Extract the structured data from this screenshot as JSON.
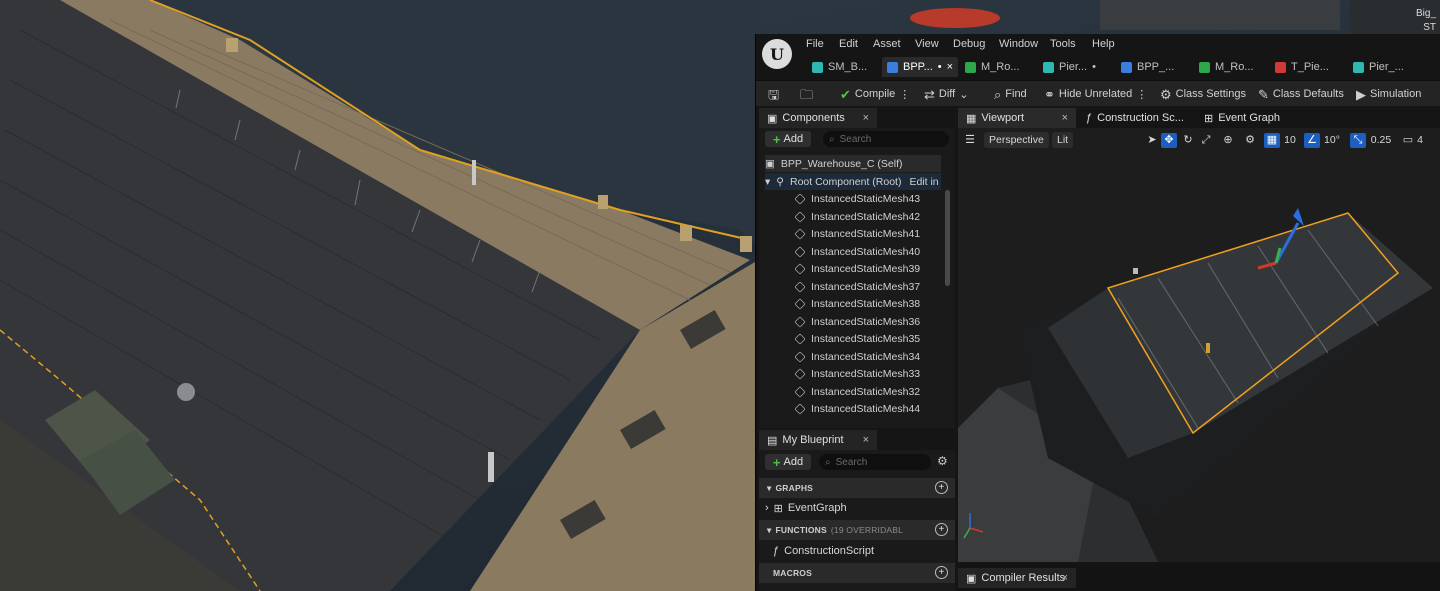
{
  "scene": {
    "corner_labels": [
      "Big_",
      "ST"
    ]
  },
  "editor": {
    "menu": [
      "File",
      "Edit",
      "Asset",
      "View",
      "Debug",
      "Window",
      "Tools",
      "Help"
    ],
    "tabs": [
      {
        "label": "SM_B...",
        "color": "#2fb8b0",
        "active": false,
        "dot": ""
      },
      {
        "label": "BPP...",
        "color": "#3a7fe0",
        "active": true,
        "dot": "•"
      },
      {
        "label": "M_Ro...",
        "color": "#2aa84a",
        "active": false,
        "dot": ""
      },
      {
        "label": "Pier...",
        "color": "#2fb8b0",
        "active": false,
        "dot": "•"
      },
      {
        "label": "BPP_...",
        "color": "#3a7fe0",
        "active": false,
        "dot": ""
      },
      {
        "label": "M_Ro...",
        "color": "#2aa84a",
        "active": false,
        "dot": ""
      },
      {
        "label": "T_Pie...",
        "color": "#d03a3a",
        "active": false,
        "dot": ""
      },
      {
        "label": "Pier_...",
        "color": "#2fb8b0",
        "active": false,
        "dot": ""
      }
    ],
    "toolbar": {
      "compile": "Compile",
      "diff": "Diff",
      "find": "Find",
      "hide_unrelated": "Hide Unrelated",
      "class_settings": "Class Settings",
      "class_defaults": "Class Defaults",
      "simulation": "Simulation"
    },
    "components": {
      "title": "Components",
      "add": "Add",
      "search_placeholder": "Search",
      "self": "BPP_Warehouse_C (Self)",
      "root": "Root Component (Root)",
      "edit_in": "Edit in",
      "items": [
        "InstancedStaticMesh43",
        "InstancedStaticMesh42",
        "InstancedStaticMesh41",
        "InstancedStaticMesh40",
        "InstancedStaticMesh39",
        "InstancedStaticMesh37",
        "InstancedStaticMesh38",
        "InstancedStaticMesh36",
        "InstancedStaticMesh35",
        "InstancedStaticMesh34",
        "InstancedStaticMesh33",
        "InstancedStaticMesh32",
        "InstancedStaticMesh44"
      ]
    },
    "my_blueprint": {
      "title": "My Blueprint",
      "add": "Add",
      "search_placeholder": "Search",
      "graphs": "GRAPHS",
      "event_graph": "EventGraph",
      "functions": "FUNCTIONS",
      "functions_note": "(19 OVERRIDABL",
      "construction_script": "ConstructionScript",
      "macros": "MACROS"
    },
    "viewport_tabs": {
      "viewport": "Viewport",
      "construction": "Construction Sc...",
      "event_graph": "Event Graph"
    },
    "viewport_toolbar": {
      "perspective": "Perspective",
      "lit": "Lit",
      "grid_snap": "10",
      "rot_snap": "10°",
      "scale_snap": "0.25",
      "camera_speed": "4"
    },
    "compiler_results": "Compiler Results"
  }
}
